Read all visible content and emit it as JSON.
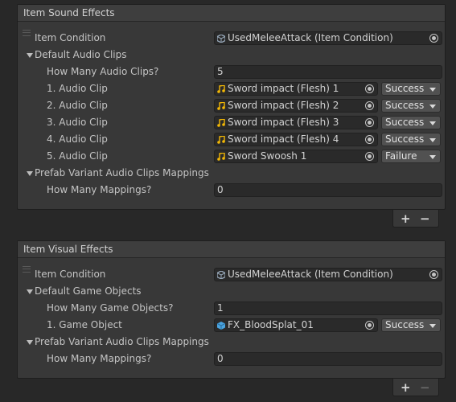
{
  "sound_panel": {
    "title": "Item Sound Effects",
    "item_condition_label": "Item Condition",
    "item_condition_value": "UsedMeleeAttack (Item Condition)",
    "default_clips_label": "Default Audio Clips",
    "count_label": "How Many Audio Clips?",
    "count_value": "5",
    "clips": [
      {
        "label": "1. Audio Clip",
        "value": "Sword impact (Flesh) 1",
        "result": "Success"
      },
      {
        "label": "2. Audio Clip",
        "value": "Sword impact (Flesh) 2",
        "result": "Success"
      },
      {
        "label": "3. Audio Clip",
        "value": "Sword impact (Flesh) 3",
        "result": "Success"
      },
      {
        "label": "4. Audio Clip",
        "value": "Sword impact (Flesh) 4",
        "result": "Success"
      },
      {
        "label": "5. Audio Clip",
        "value": "Sword Swoosh 1",
        "result": "Failure"
      }
    ],
    "mappings_label": "Prefab Variant Audio Clips Mappings",
    "mappings_count_label": "How Many Mappings?",
    "mappings_count_value": "0"
  },
  "visual_panel": {
    "title": "Item Visual Effects",
    "item_condition_label": "Item Condition",
    "item_condition_value": "UsedMeleeAttack (Item Condition)",
    "default_objects_label": "Default Game Objects",
    "count_label": "How Many Game Objects?",
    "count_value": "1",
    "objects": [
      {
        "label": "1. Game Object",
        "value": "FX_BloodSplat_01",
        "result": "Success"
      }
    ],
    "mappings_label": "Prefab Variant Audio Clips Mappings",
    "mappings_count_label": "How Many Mappings?",
    "mappings_count_value": "0"
  },
  "footer": {
    "add_label": "+",
    "remove_label": "−"
  },
  "icons": {
    "condition": "scriptable-object-icon",
    "audio": "audio-clip-icon",
    "prefab": "prefab-icon",
    "picker": "object-picker-icon",
    "foldout": "foldout-arrow-icon"
  },
  "colors": {
    "audio_icon": "#f2b705",
    "prefab_icon": "#4aa3df",
    "condition_icon": "#9ab"
  }
}
